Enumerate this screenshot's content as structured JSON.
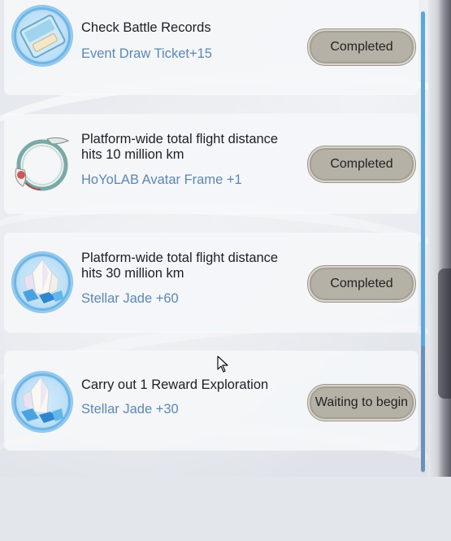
{
  "tasks": [
    {
      "title": "Check Battle Records",
      "reward": "Event Draw Ticket+15",
      "button": "Completed",
      "icon": "ticket-icon"
    },
    {
      "title": "Platform-wide total flight distance hits 10 million km",
      "reward": "HoYoLAB Avatar Frame +1",
      "button": "Completed",
      "icon": "avatar-frame-icon"
    },
    {
      "title": "Platform-wide total flight distance hits 30 million km",
      "reward": "Stellar Jade +60",
      "button": "Completed",
      "icon": "stellar-jade-icon"
    },
    {
      "title": "Carry out 1 Reward Exploration",
      "reward": "Stellar Jade +30",
      "button": "Waiting to begin",
      "icon": "stellar-jade-icon"
    }
  ],
  "colors": {
    "reward_text": "#5d87b4",
    "button_fill": "#b6b1a6",
    "scrollbar": "#5ba7e0"
  }
}
